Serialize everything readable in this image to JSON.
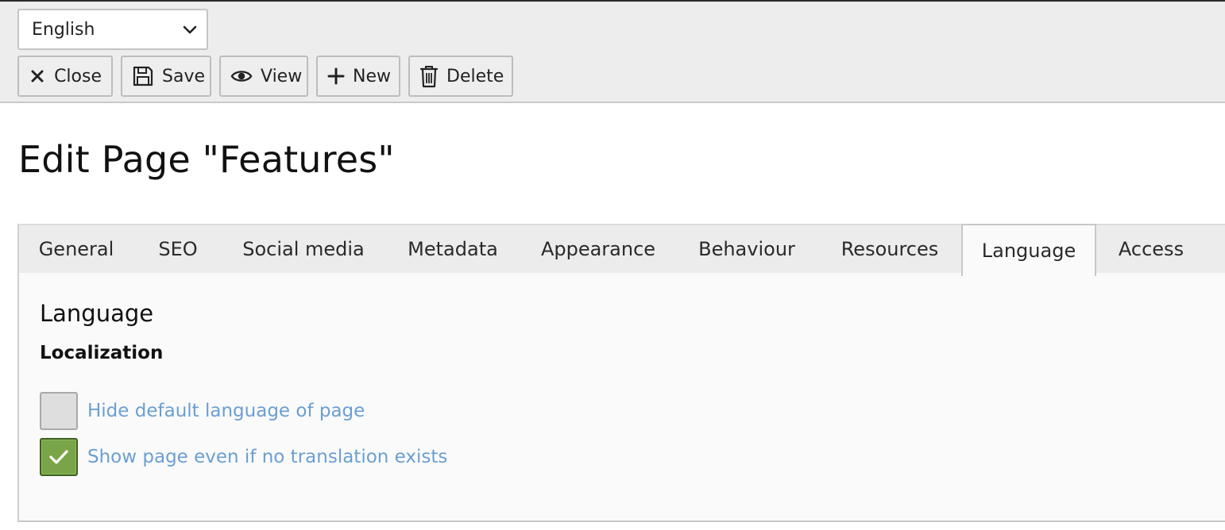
{
  "toolbar": {
    "language_select": {
      "value": "English",
      "icon": "chevron-down-icon"
    },
    "buttons": [
      {
        "label": "Close",
        "icon": "close-icon"
      },
      {
        "label": "Save",
        "icon": "save-icon"
      },
      {
        "label": "View",
        "icon": "eye-icon"
      },
      {
        "label": "New",
        "icon": "plus-icon"
      },
      {
        "label": "Delete",
        "icon": "trash-icon"
      }
    ]
  },
  "page_title": "Edit Page \"Features\"",
  "tabs": [
    {
      "label": "General",
      "active": false
    },
    {
      "label": "SEO",
      "active": false
    },
    {
      "label": "Social media",
      "active": false
    },
    {
      "label": "Metadata",
      "active": false
    },
    {
      "label": "Appearance",
      "active": false
    },
    {
      "label": "Behaviour",
      "active": false
    },
    {
      "label": "Resources",
      "active": false
    },
    {
      "label": "Language",
      "active": true
    },
    {
      "label": "Access",
      "active": false
    }
  ],
  "panel": {
    "section_title": "Language",
    "subsection_title": "Localization",
    "checkboxes": [
      {
        "label": "Hide default language of page",
        "checked": false
      },
      {
        "label": "Show page even if no translation exists",
        "checked": true
      }
    ]
  },
  "colors": {
    "link_label": "#6a9fd3",
    "checkbox_checked": "#79a548",
    "toolbar_bg": "#ededed"
  }
}
